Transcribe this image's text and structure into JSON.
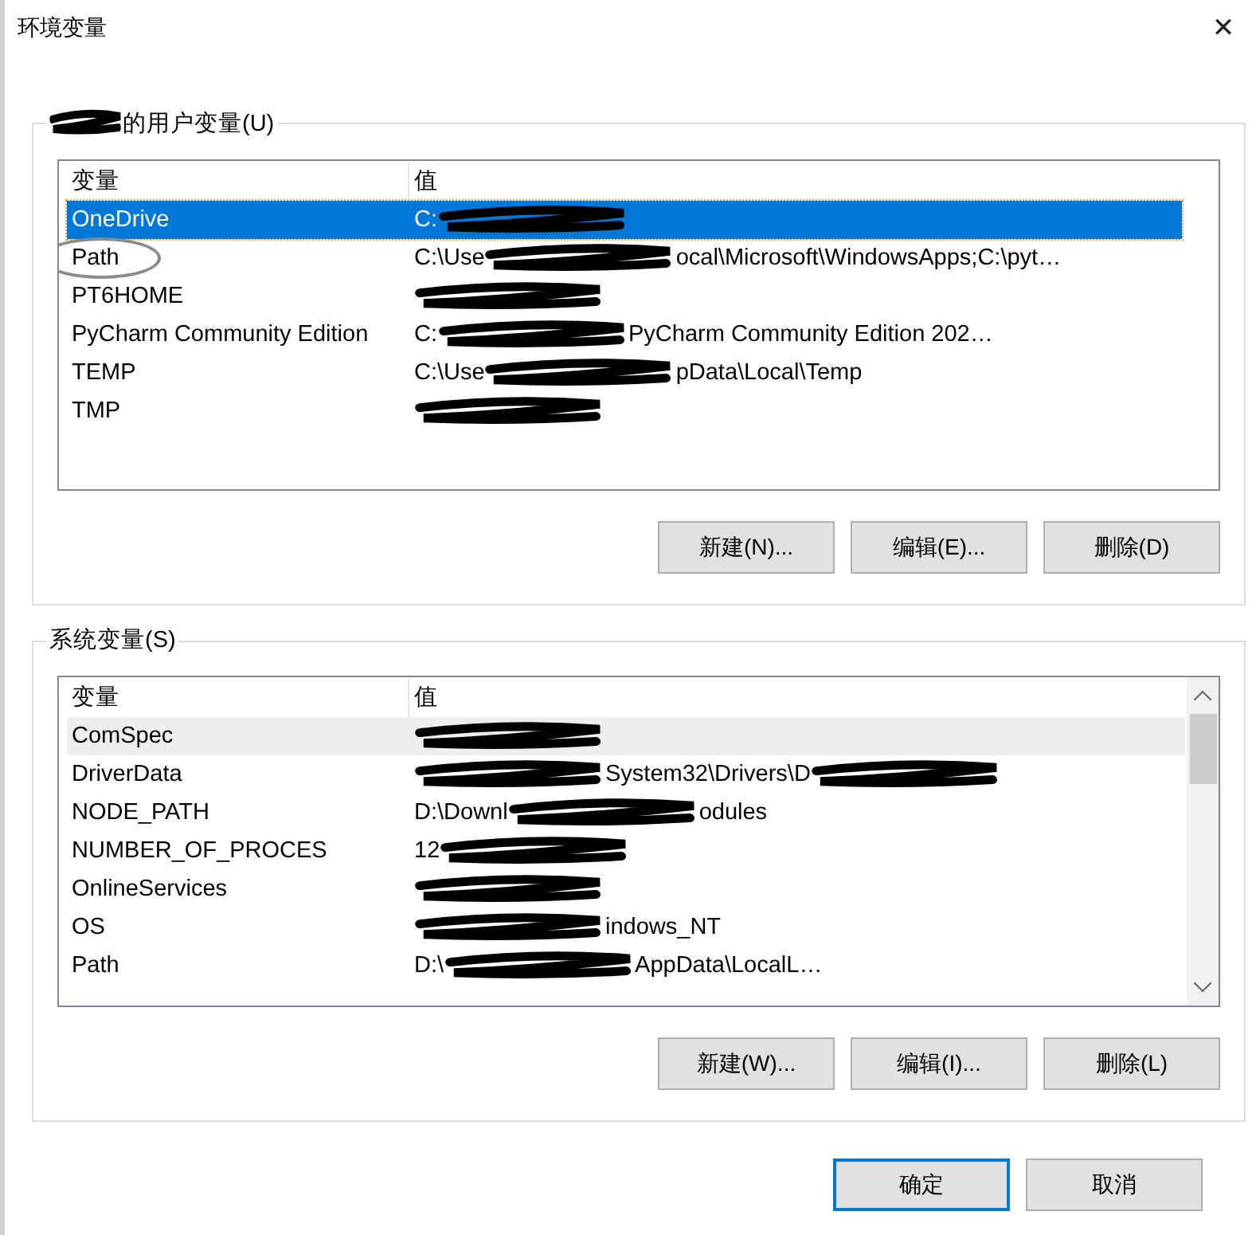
{
  "window": {
    "title": "环境变量",
    "close": "✕"
  },
  "user_vars": {
    "title_parts": [
      {
        "kind": "redacted"
      },
      {
        "kind": "text",
        "text": "的用户变量(U)"
      }
    ],
    "columns": [
      "变量",
      "值"
    ],
    "rows": [
      {
        "name": "OneDrive",
        "selected": true,
        "circled": false,
        "value": [
          {
            "kind": "text",
            "text": "C:"
          },
          {
            "kind": "redacted"
          }
        ]
      },
      {
        "name": "Path",
        "selected": false,
        "circled": true,
        "value": [
          {
            "kind": "text",
            "text": "C:\\Use"
          },
          {
            "kind": "redacted"
          },
          {
            "kind": "text",
            "text": "ocal\\Microsoft\\WindowsApps;C:\\pyt…"
          }
        ]
      },
      {
        "name": "PT6HOME",
        "selected": false,
        "circled": false,
        "value": [
          {
            "kind": "redacted"
          }
        ]
      },
      {
        "name": "PyCharm Community Edition",
        "selected": false,
        "circled": false,
        "value": [
          {
            "kind": "text",
            "text": "C:"
          },
          {
            "kind": "redacted"
          },
          {
            "kind": "text",
            "text": "PyCharm Community Edition 202…"
          }
        ]
      },
      {
        "name": "TEMP",
        "selected": false,
        "circled": false,
        "value": [
          {
            "kind": "text",
            "text": "C:\\Use"
          },
          {
            "kind": "redacted"
          },
          {
            "kind": "text",
            "text": "pData\\Local\\Temp"
          }
        ]
      },
      {
        "name": "TMP",
        "selected": false,
        "circled": false,
        "value": [
          {
            "kind": "redacted"
          }
        ]
      }
    ],
    "buttons": [
      "新建(N)...",
      "编辑(E)...",
      "删除(D)"
    ]
  },
  "system_vars": {
    "title": "系统变量(S)",
    "columns": [
      "变量",
      "值"
    ],
    "rows": [
      {
        "name": "ComSpec",
        "selected": true,
        "value": [
          {
            "kind": "redacted"
          }
        ]
      },
      {
        "name": "DriverData",
        "selected": false,
        "value": [
          {
            "kind": "redacted"
          },
          {
            "kind": "text",
            "text": "System32\\Drivers\\D"
          },
          {
            "kind": "redacted"
          }
        ]
      },
      {
        "name": "NODE_PATH",
        "selected": false,
        "value": [
          {
            "kind": "text",
            "text": "D:\\Downl"
          },
          {
            "kind": "redacted"
          },
          {
            "kind": "text",
            "text": "odules"
          }
        ]
      },
      {
        "name": "NUMBER_OF_PROCES",
        "selected": false,
        "value": [
          {
            "kind": "text",
            "text": "12"
          },
          {
            "kind": "redacted"
          }
        ]
      },
      {
        "name": "OnlineServices",
        "selected": false,
        "value": [
          {
            "kind": "redacted"
          }
        ]
      },
      {
        "name": "OS",
        "selected": false,
        "value": [
          {
            "kind": "redacted"
          },
          {
            "kind": "text",
            "text": "indows_NT"
          }
        ]
      },
      {
        "name": "Path",
        "selected": false,
        "value": [
          {
            "kind": "text",
            "text": "D:\\"
          },
          {
            "kind": "redacted"
          },
          {
            "kind": "text",
            "text": "AppData\\LocalL…"
          }
        ]
      }
    ],
    "buttons": [
      "新建(W)...",
      "编辑(I)...",
      "删除(L)"
    ]
  },
  "footer_buttons": [
    {
      "label": "确定",
      "default": true
    },
    {
      "label": "取消",
      "default": false
    }
  ]
}
